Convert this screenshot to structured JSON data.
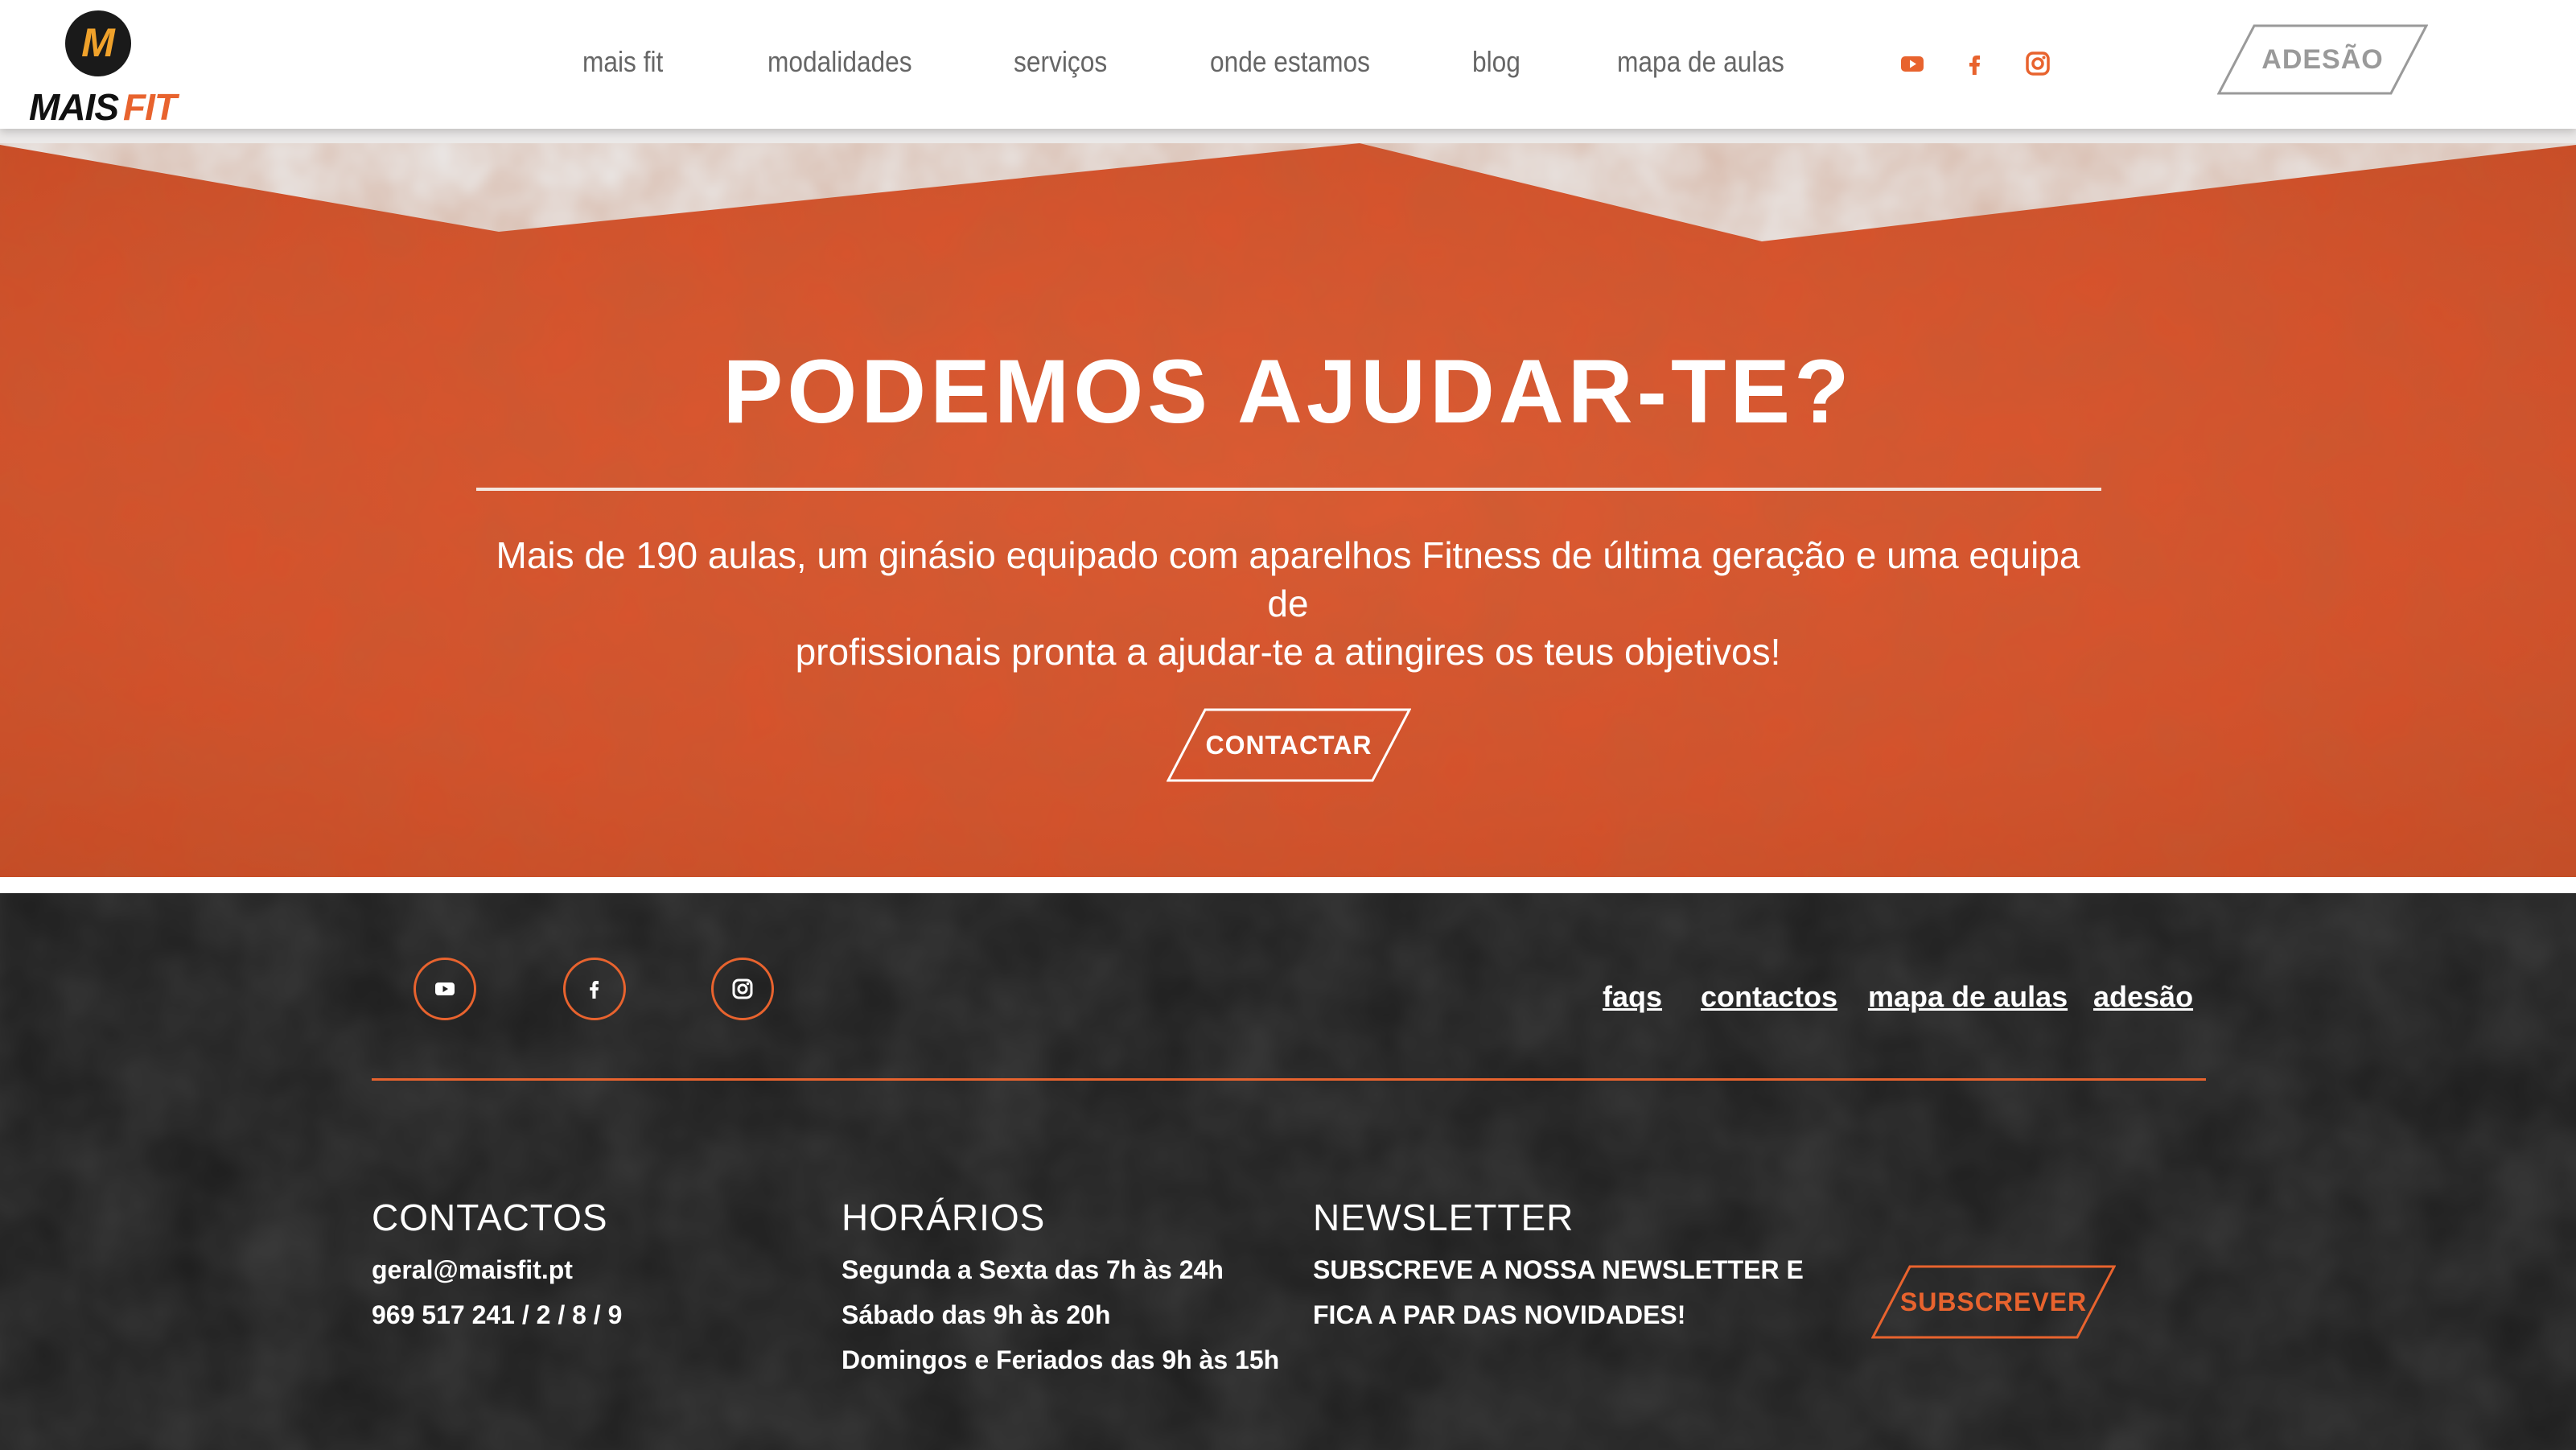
{
  "colors": {
    "accent": "#e8632e",
    "hero_orange": "#d9532d",
    "footer_dark": "#1c1c1c",
    "nav_text": "#666666",
    "page_bg": "#ebe9e8"
  },
  "logo": {
    "mark_letter": "M",
    "word_main": "MAIS",
    "word_accent": "FIT"
  },
  "nav": {
    "items": [
      {
        "label": "mais fit"
      },
      {
        "label": "modalidades"
      },
      {
        "label": "serviços"
      },
      {
        "label": "onde estamos"
      },
      {
        "label": "blog"
      },
      {
        "label": "mapa de aulas"
      }
    ],
    "social_icons": [
      "youtube-icon",
      "facebook-icon",
      "instagram-icon"
    ],
    "cta_label": "ADESÃO"
  },
  "hero": {
    "title": "PODEMOS AJUDAR-TE?",
    "text_line1": "Mais de 190 aulas, um ginásio equipado com aparelhos Fitness de última geração e uma equipa de",
    "text_line2": "profissionais pronta a ajudar-te a atingires os teus objetivos!",
    "button_label": "CONTACTAR"
  },
  "footer": {
    "social_icons": [
      "youtube-icon",
      "facebook-icon",
      "instagram-icon"
    ],
    "links": [
      {
        "label": "faqs"
      },
      {
        "label": "contactos"
      },
      {
        "label": "mapa de aulas"
      },
      {
        "label": "adesão"
      }
    ],
    "contactos": {
      "heading": "CONTACTOS",
      "email": "geral@maisfit.pt",
      "phone": "969 517 241 / 2 / 8 / 9"
    },
    "horarios": {
      "heading": "HORÁRIOS",
      "lines": [
        "Segunda a Sexta das 7h às 24h",
        "Sábado das 9h às 20h",
        "Domingos e Feriados das 9h às 15h"
      ]
    },
    "newsletter": {
      "heading": "NEWSLETTER",
      "line1": "SUBSCREVE A NOSSA NEWSLETTER E",
      "line2": "FICA A PAR DAS NOVIDADES!",
      "button_label": "SUBSCREVER"
    }
  }
}
